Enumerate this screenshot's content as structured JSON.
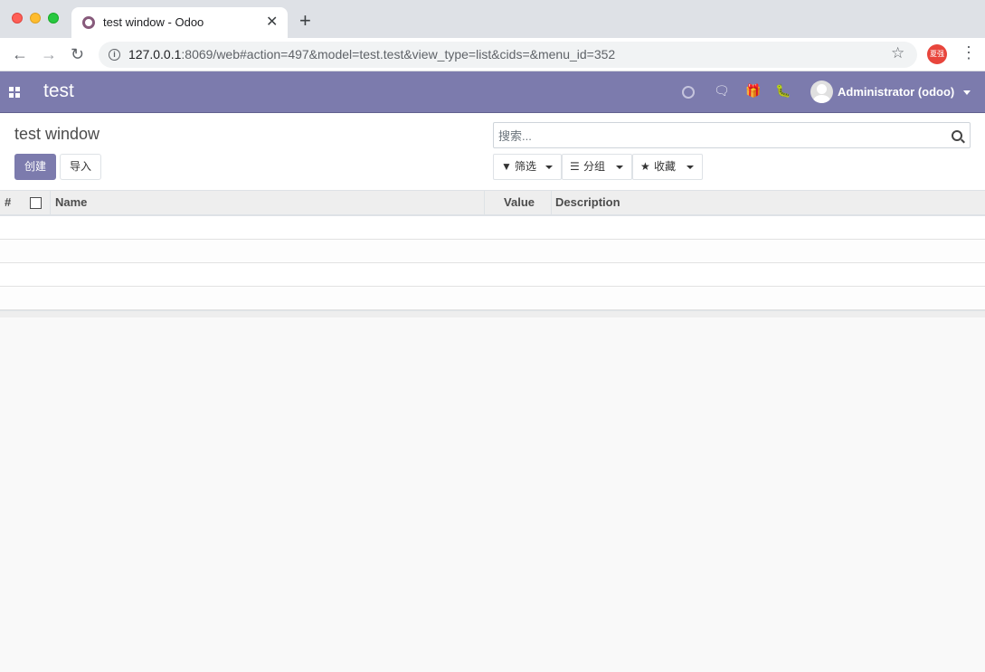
{
  "browser": {
    "tab_title": "test window - Odoo",
    "tab_close": "✕",
    "new_tab": "+",
    "url_host": "127.0.0.1",
    "url_rest": ":8069/web#action=497&model=test.test&view_type=list&cids=&menu_id=352",
    "profile_label": "夏强",
    "icons": {
      "back": "arrow-left-icon",
      "forward": "arrow-right-icon",
      "reload": "reload-icon",
      "info": "info-icon",
      "star": "star-icon",
      "menu": "more-vert-icon"
    }
  },
  "navbar": {
    "brand": "test",
    "user": "Administrator (odoo)",
    "icons": [
      "apps-icon",
      "clock-icon",
      "chat-icon",
      "gift-icon",
      "bug-icon"
    ]
  },
  "control_panel": {
    "breadcrumb": "test window",
    "create_label": "创建",
    "import_label": "导入",
    "search_placeholder": "搜索...",
    "filters_label": "筛选",
    "groupby_label": "分组",
    "favorites_label": "收藏"
  },
  "list": {
    "columns": [
      "#",
      "",
      "Name",
      "Value",
      "Description"
    ],
    "rows": []
  },
  "colors": {
    "navbar": "#7c7bad",
    "primary_button": "#7c7bad",
    "background": "#f9f9f9"
  }
}
